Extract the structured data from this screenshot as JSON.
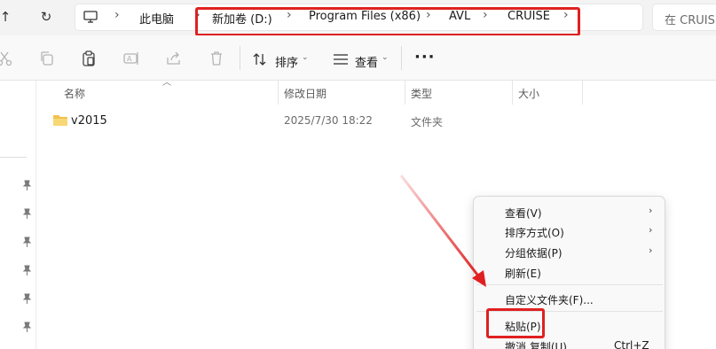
{
  "address_bar": {
    "crumbs": [
      "此电脑",
      "新加卷 (D:)",
      "Program Files (x86)",
      "AVL",
      "CRUISE"
    ],
    "separator": "›"
  },
  "search": {
    "placeholder": "在 CRUISE"
  },
  "toolbar": {
    "sort_label": "排序",
    "view_label": "查看",
    "more_label": "···"
  },
  "columns": {
    "name": "名称",
    "modified": "修改日期",
    "type": "类型",
    "size": "大小"
  },
  "files": [
    {
      "name": "v2015",
      "modified": "2025/7/30 18:22",
      "type": "文件夹"
    }
  ],
  "context_menu": {
    "items": [
      {
        "label": "查看(V)",
        "submenu": true
      },
      {
        "label": "排序方式(O)",
        "submenu": true
      },
      {
        "label": "分组依据(P)",
        "submenu": true
      },
      {
        "label": "刷新(E)",
        "submenu": false
      },
      {
        "label": "自定义文件夹(F)...",
        "submenu": false
      },
      {
        "label": "粘贴(P)",
        "submenu": false
      },
      {
        "label": "撤消 复制(U)",
        "submenu": false,
        "shortcut": "Ctrl+Z"
      }
    ]
  },
  "colors": {
    "annotation_red": "#e02020",
    "folder_yellow": "#f2c14e"
  }
}
